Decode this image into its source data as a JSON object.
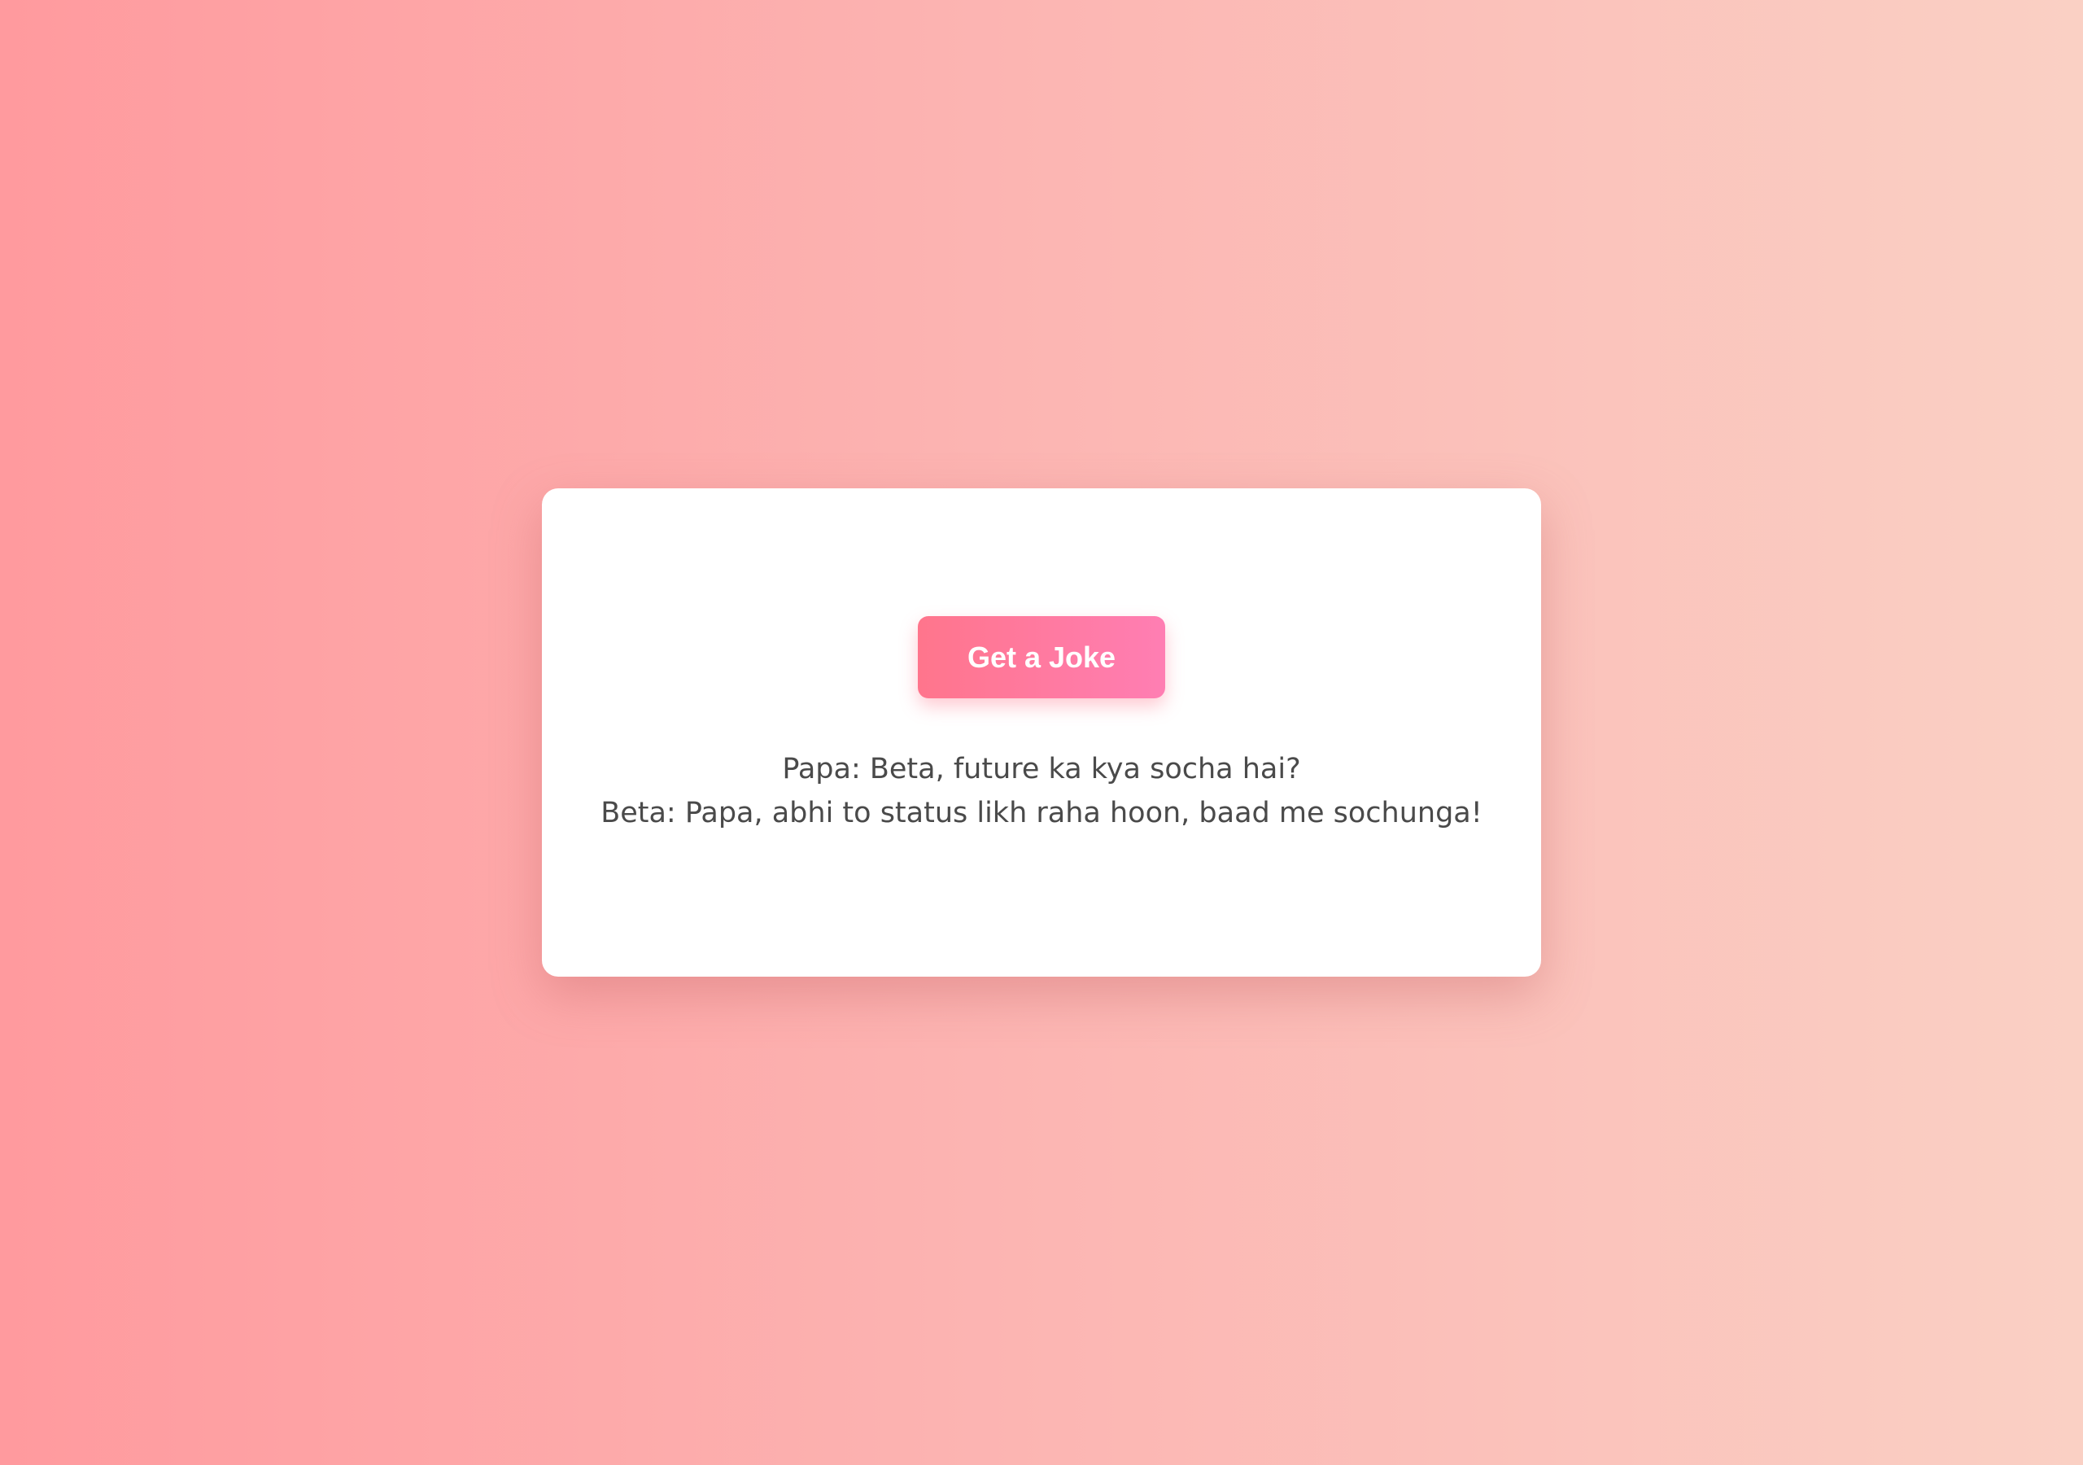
{
  "button": {
    "label": "Get a Joke"
  },
  "joke": {
    "line1": "Papa: Beta, future ka kya socha hai?",
    "line2": "Beta: Papa, abhi to status likh raha hoon, baad me sochunga!"
  },
  "colors": {
    "background_start": "#ff9a9e",
    "background_end": "#fad0c4",
    "button_start": "#ff758c",
    "button_end": "#ff7eb3",
    "card": "#ffffff",
    "text": "#4a4a4a"
  }
}
